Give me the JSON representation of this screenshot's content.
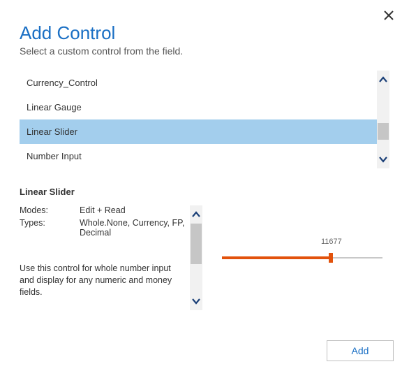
{
  "dialog": {
    "title": "Add Control",
    "subtitle": "Select a custom control from the field."
  },
  "controls": {
    "items": [
      {
        "label": "Currency_Control",
        "selected": false
      },
      {
        "label": "Linear Gauge",
        "selected": false
      },
      {
        "label": "Linear Slider",
        "selected": true
      },
      {
        "label": "Number Input",
        "selected": false
      }
    ]
  },
  "detail": {
    "title": "Linear Slider",
    "modes_label": "Modes:",
    "modes_value": "Edit + Read",
    "types_label": "Types:",
    "types_value": "Whole.None, Currency, FP, Decimal",
    "description": "Use this control for whole number input and display for any numeric and money fields."
  },
  "preview": {
    "slider_value": "11677",
    "fill_percent": 68
  },
  "footer": {
    "add_label": "Add"
  }
}
